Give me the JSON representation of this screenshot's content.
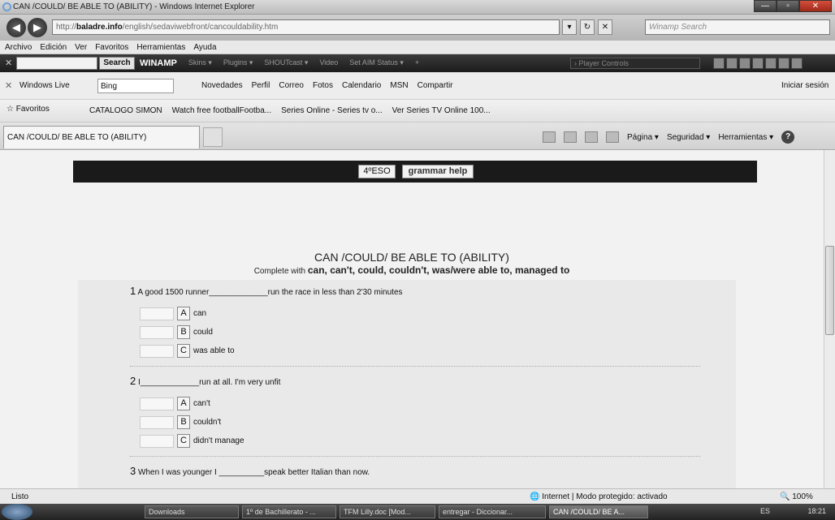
{
  "window": {
    "title": "CAN /COULD/ BE ABLE TO (ABILITY) - Windows Internet Explorer"
  },
  "address": {
    "url_prefix": "http://",
    "url_domain": "baladre.info",
    "url_path": "/english/sedaviwebfront/cancouldability.htm",
    "search_placeholder": "Winamp Search"
  },
  "menu": [
    "Archivo",
    "Edición",
    "Ver",
    "Favoritos",
    "Herramientas",
    "Ayuda"
  ],
  "winamp": {
    "search_button": "Search",
    "brand": "WINAMP",
    "items": [
      "Skins ▾",
      "Plugins ▾",
      "SHOUTcast ▾",
      "Video",
      "Set AIM Status ▾",
      "+"
    ],
    "player": "› Player Controls"
  },
  "live": {
    "label": "Windows Live",
    "bing": "Bing",
    "links": [
      "Novedades",
      "Perfil",
      "Correo",
      "Fotos",
      "Calendario",
      "MSN",
      "Compartir"
    ],
    "signin": "Iniciar sesión"
  },
  "favorites": {
    "label": "Favoritos",
    "links": [
      "CATALOGO SIMON",
      "Watch free footballFootba...",
      "Series Online - Series tv o...",
      "Ver Series TV Online 100..."
    ]
  },
  "tab": {
    "title": "CAN /COULD/ BE ABLE TO (ABILITY)"
  },
  "commands": [
    "Página ▾",
    "Seguridad ▾",
    "Herramientas ▾"
  ],
  "page": {
    "nav": {
      "level": "4ºESO",
      "help": "grammar help"
    },
    "title": "CAN /COULD/ BE ABLE TO (ABILITY)",
    "instr_prefix": "Complete with",
    "instr_bold": "can, can't, could, couldn't, was/were able to, managed to",
    "questions": [
      {
        "num": "1",
        "text": "A good 1500 runner_____________run the race in less than 2'30 minutes",
        "options": [
          {
            "letter": "A",
            "text": "can"
          },
          {
            "letter": "B",
            "text": "could"
          },
          {
            "letter": "C",
            "text": "was able to"
          }
        ]
      },
      {
        "num": "2",
        "text": "I_____________run at all. I'm very unfit",
        "options": [
          {
            "letter": "A",
            "text": "can't"
          },
          {
            "letter": "B",
            "text": "couldn't"
          },
          {
            "letter": "C",
            "text": "didn't manage"
          }
        ]
      },
      {
        "num": "3",
        "text": "When I was younger I __________speak better Italian than now."
      }
    ]
  },
  "status": {
    "left": "Listo",
    "zone": "Internet | Modo protegido: activado",
    "zoom": "100%"
  },
  "taskbar": {
    "items": [
      "Downloads",
      "1º de Bachillerato - ...",
      "TFM Lilly.doc [Mod...",
      "entregar - Diccionar...",
      "CAN /COULD/ BE A..."
    ],
    "lang": "ES",
    "time": "18:21"
  }
}
